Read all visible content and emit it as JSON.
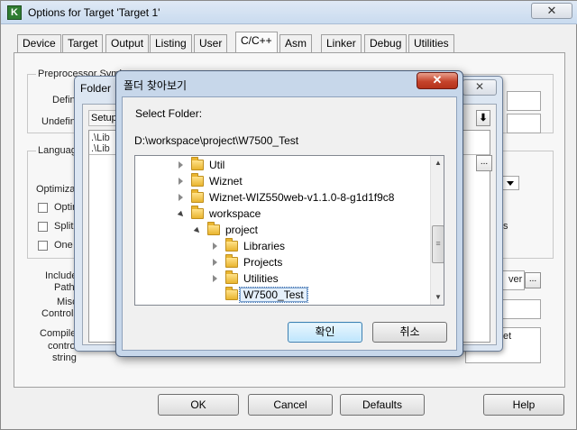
{
  "main": {
    "title": "Options for Target 'Target 1'",
    "close_glyph": "✕",
    "tabs": [
      "Device",
      "Target",
      "Output",
      "Listing",
      "User",
      "C/C++",
      "Asm",
      "Linker",
      "Debug",
      "Utilities"
    ],
    "active_tab": "C/C++",
    "preprocessor_label": "Preprocessor Symb",
    "define_label": "Defin",
    "undefine_label": "Undefin",
    "language_label": "Languag",
    "optimization_label": "Optimizat",
    "option_labels": [
      "Optin",
      "Split",
      "One"
    ],
    "include_labels": [
      "Include",
      "Paths",
      "Misc",
      "Controls",
      "Compile",
      "contro",
      "string"
    ],
    "right_labels": [
      "ver",
      "s",
      "et"
    ],
    "ellipsis": "...",
    "buttons": {
      "ok": "OK",
      "cancel": "Cancel",
      "defaults": "Defaults",
      "help": "Help"
    }
  },
  "folder_dialog": {
    "title": "Folder",
    "setup_label": "Setup",
    "rows": [
      ".\\Lib",
      ".\\Lib"
    ],
    "ellipsis": "..."
  },
  "browse_dialog": {
    "title": "폴더 찾아보기",
    "close_glyph": "✕",
    "prompt": "Select Folder:",
    "path": "D:\\workspace\\project\\W7500_Test",
    "tree": [
      {
        "name": "Util",
        "expander": "closed",
        "level": 0
      },
      {
        "name": "Wiznet",
        "expander": "closed",
        "level": 0
      },
      {
        "name": "Wiznet-WIZ550web-v1.1.0-8-g1d1f9c8",
        "expander": "closed",
        "level": 0
      },
      {
        "name": "workspace",
        "expander": "open",
        "level": 0
      },
      {
        "name": "project",
        "expander": "open",
        "level": 1
      },
      {
        "name": "Libraries",
        "expander": "closed",
        "level": 2
      },
      {
        "name": "Projects",
        "expander": "closed",
        "level": 2
      },
      {
        "name": "Utilities",
        "expander": "closed",
        "level": 2
      },
      {
        "name": "W7500_Test",
        "expander": "none",
        "level": 2,
        "selected": true
      }
    ],
    "ok_label": "확인",
    "cancel_label": "취소",
    "scroll_thumb_glyph": "≡"
  }
}
